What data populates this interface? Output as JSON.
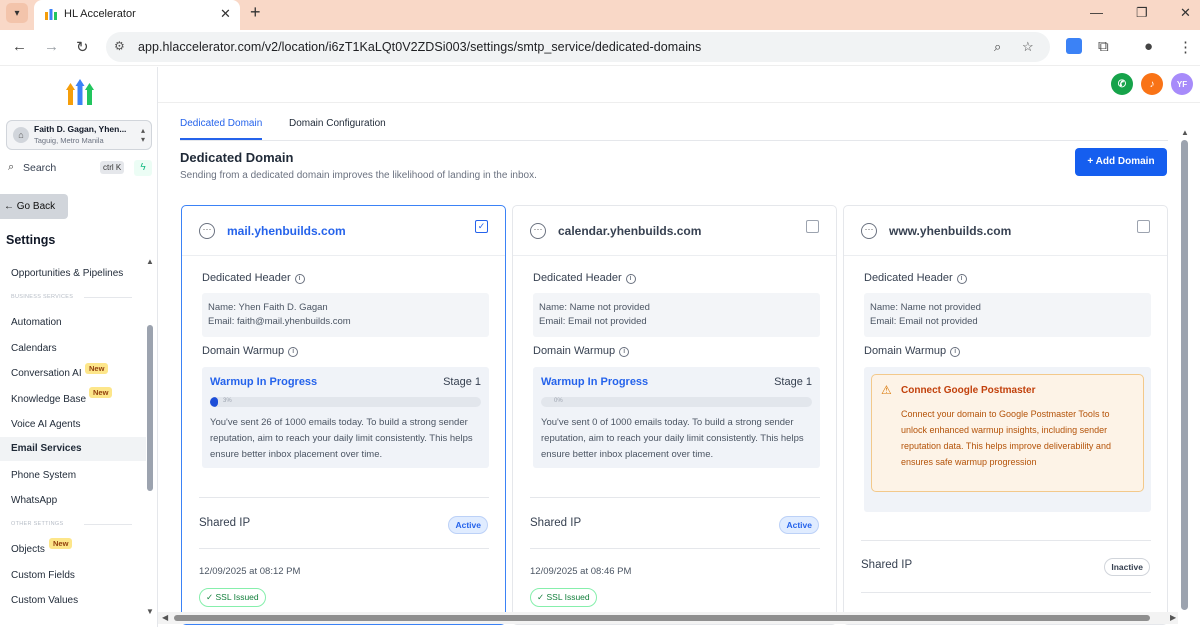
{
  "browser": {
    "tab_title": "HL Accelerator",
    "url": "app.hlaccelerator.com/v2/location/i6zT1KaLQt0V2ZDSi003/settings/smtp_service/dedicated-domains"
  },
  "sidebar": {
    "account_name": "Faith D. Gagan, Yhen...",
    "account_location": "Taguig, Metro Manila",
    "search_label": "Search",
    "search_shortcut": "ctrl K",
    "go_back": "Go Back",
    "settings_title": "Settings",
    "section_business": "BUSINESS SERVICES",
    "section_other": "OTHER SETTINGS",
    "new_badge": "New",
    "items": [
      {
        "label": "Opportunities & Pipelines"
      },
      {
        "label": "Automation"
      },
      {
        "label": "Calendars"
      },
      {
        "label": "Conversation AI"
      },
      {
        "label": "Knowledge Base"
      },
      {
        "label": "Voice AI Agents"
      },
      {
        "label": "Email Services"
      },
      {
        "label": "Phone System"
      },
      {
        "label": "WhatsApp"
      },
      {
        "label": "Objects"
      },
      {
        "label": "Custom Fields"
      },
      {
        "label": "Custom Values"
      }
    ]
  },
  "topbar": {
    "avatar_initials": "YF"
  },
  "main": {
    "tabs": [
      {
        "label": "Dedicated Domain"
      },
      {
        "label": "Domain Configuration"
      }
    ],
    "title": "Dedicated Domain",
    "subtitle": "Sending from a dedicated domain improves the likelihood of landing in the inbox.",
    "add_button": "+ Add Domain",
    "labels": {
      "dedicated_header": "Dedicated Header",
      "domain_warmup": "Domain Warmup",
      "shared_ip": "Shared IP",
      "warmup_in_progress": "Warmup In Progress"
    },
    "cards": [
      {
        "domain": "mail.yhenbuilds.com",
        "checked": true,
        "name": "Name: Yhen Faith D. Gagan",
        "email": "Email: faith@mail.yhenbuilds.com",
        "stage": "Stage 1",
        "progress_label": "3%",
        "progress_fraction": 0.026,
        "warmup_text": "You've sent 26 of 1000 emails today. To build a strong sender reputation, aim to reach your daily limit consistently. This helps ensure better inbox placement over time.",
        "ip_status": "Active",
        "date": "12/09/2025 at 08:12 PM",
        "ssl": "SSL Issued"
      },
      {
        "domain": "calendar.yhenbuilds.com",
        "checked": false,
        "name": "Name: Name not provided",
        "email": "Email: Email not provided",
        "stage": "Stage 1",
        "progress_label": "0%",
        "progress_fraction": 0,
        "warmup_text": "You've sent 0 of 1000 emails today. To build a strong sender reputation, aim to reach your daily limit consistently. This helps ensure better inbox placement over time.",
        "ip_status": "Active",
        "date": "12/09/2025 at 08:46 PM",
        "ssl": "SSL Issued"
      },
      {
        "domain": "www.yhenbuilds.com",
        "checked": false,
        "name": "Name: Name not provided",
        "email": "Email: Email not provided",
        "postmaster_title": "Connect Google Postmaster",
        "postmaster_text": "Connect your domain to Google Postmaster Tools to unlock enhanced warmup insights, including sender reputation data. This helps improve deliverability and ensures safe warmup progression",
        "ip_status": "Inactive"
      }
    ]
  },
  "colors": {
    "accent": "#155eef",
    "active_link": "#2563eb",
    "phone_icon": "#16a34a",
    "bell_icon": "#f97316",
    "avatar": "#a78bfa"
  }
}
